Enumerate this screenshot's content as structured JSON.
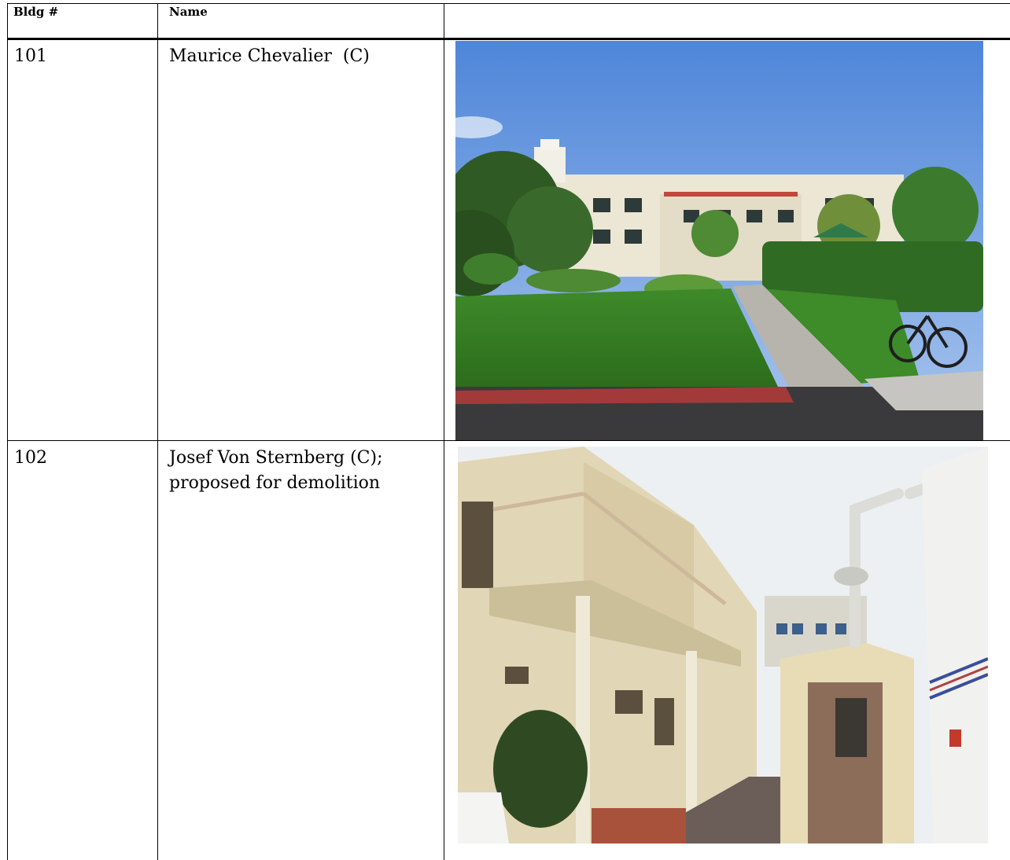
{
  "header": {
    "col_bldg": "Bldg #",
    "col_name": "Name",
    "col_photo": ""
  },
  "rows": [
    {
      "bldg": "101",
      "name": "Maurice Chevalier  (C)",
      "photo": "photo-courtyard-lawn-building"
    },
    {
      "bldg": "102",
      "name_line1": "Josef Von Sternberg (C);",
      "name_line2": "proposed for demolition",
      "photo": "photo-alley-balcony-building"
    }
  ]
}
